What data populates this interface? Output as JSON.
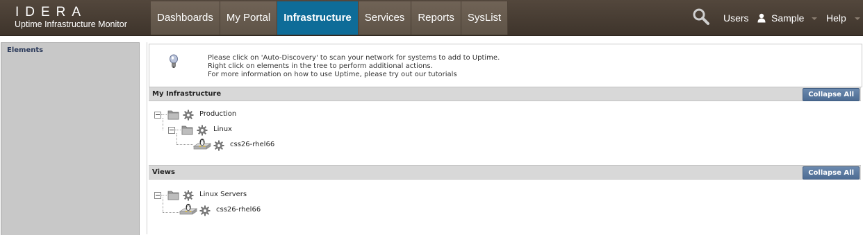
{
  "brand": {
    "logo": "IDERA",
    "subtitle": "Uptime Infrastructure Monitor"
  },
  "nav": {
    "tabs": [
      {
        "label": "Dashboards"
      },
      {
        "label": "My Portal"
      },
      {
        "label": "Infrastructure",
        "active": true
      },
      {
        "label": "Services"
      },
      {
        "label": "Reports"
      },
      {
        "label": "SysList"
      }
    ],
    "users_label": "Users",
    "user_name": "Sample",
    "help_label": "Help"
  },
  "sidebar": {
    "title": "Elements"
  },
  "info": {
    "line1": "Please click on 'Auto-Discovery' to scan your network for systems to add to Uptime.",
    "line2": "Right click on elements in the tree to perform additional actions.",
    "line3_prefix": "For more information on how to use Uptime, please try out our ",
    "line3_link": "tutorials"
  },
  "my_infrastructure": {
    "title": "My Infrastructure",
    "collapse_label": "Collapse All",
    "tree": {
      "group": "Production",
      "subgroup": "Linux",
      "host": "css26-rhel66"
    }
  },
  "views": {
    "title": "Views",
    "collapse_label": "Collapse All",
    "tree": {
      "group": "Linux Servers",
      "host": "css26-rhel66"
    }
  },
  "colors": {
    "header_bg": "#4a3f35",
    "tab_bg": "#6a5e51",
    "active_tab": "#0e6c98",
    "button_blue": "#5b7aa0"
  },
  "icons": [
    "search-icon",
    "user-icon",
    "lightbulb-icon",
    "folder-icon",
    "gear-icon",
    "linux-host-icon"
  ]
}
